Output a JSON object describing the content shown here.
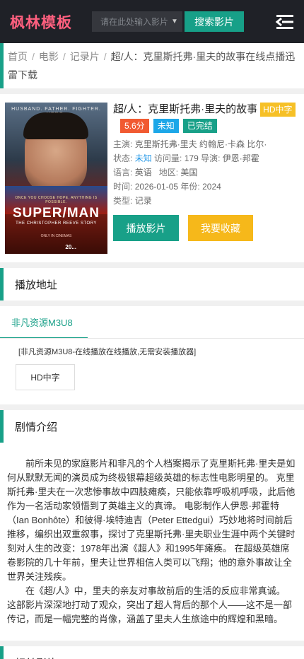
{
  "header": {
    "logo": "枫林模板",
    "search_placeholder": "请在此处输入影片",
    "search_button": "搜索影片"
  },
  "breadcrumb": {
    "home": "首页",
    "category": "电影",
    "subcategory": "记录片",
    "current": "超/人：克里斯托弗·里夫的故事在线点播迅雷下载"
  },
  "movie": {
    "title": "超/人：克里斯托弗·里夫的故事",
    "quality_badge": "HD中字",
    "score": "5.6分",
    "status_unknown": "未知",
    "finished": "已完结",
    "cast_label": "主演:",
    "cast": "克里斯托弗·里夫  约翰尼·卡森  比尔·",
    "state_label": "状态:",
    "state": "未知",
    "views_label": "访问量:",
    "views": "179",
    "director_label": "导演:",
    "director": "伊恩·邦霍",
    "language_label": "语言:",
    "language": "英语",
    "region_label": "地区:",
    "region": "美国",
    "time_label": "时间:",
    "time": "2026-01-05",
    "year_label": "年份:",
    "year": "2024",
    "type_label": "类型:",
    "type": "记录",
    "play_button": "播放影片",
    "fav_button": "我要收藏"
  },
  "poster": {
    "tagline": "HUSBAND. FATHER. FIGHTER. HERO.",
    "small": "ONCE YOU CHOOSE HOPE, ANYTHING IS POSSIBLE.",
    "brand": "SUPER/MAN",
    "brand_sub": "THE CHRISTOPHER REEVE STORY",
    "date": "ONLY IN CINEMAS",
    "stamp": "20..."
  },
  "play_section": {
    "heading": "播放地址",
    "source_tab": "非凡资源M3U8",
    "source_note": "[非凡资源M3U8-在线播放在线播放,无需安装播放器]",
    "episode": "HD中字"
  },
  "plot_section": {
    "heading": "剧情介绍",
    "para1": "前所未见的家庭影片和非凡的个人档案揭示了克里斯托弗·里夫是如何从默默无闻的演员成为终极银幕超级英雄的标志性电影明星的。 克里斯托弗·里夫在一次悲惨事故中四肢瘫痪，只能依靠呼吸机呼吸，此后他作为一名活动家领悟到了英雄主义的真谛。 电影制作人伊恩·邦霍特（Ian Bonhôte）和彼得·埃特迪吉（Peter Ettedgui）巧妙地将时间前后推移，编织出双重叙事，探讨了克里斯托弗·里夫职业生涯中两个关键时刻对人生的改变：1978年出演《超人》和1995年瘫痪。 在超级英雄席卷影院的几十年前，里夫让世界相信人类可以飞翔；他的意外事故让全世界关注残疾。",
    "para2": "在《超/人》中，里夫的亲友对事故前后的生活的反应非常真诚。 这部影片深深地打动了观众，突出了超人背后的那个人——这不是一部传记，而是一幅完整的肖像，涵盖了里夫人生旅途中的辉煌和黑暗。"
  },
  "related_section": {
    "heading": "相关影片"
  }
}
